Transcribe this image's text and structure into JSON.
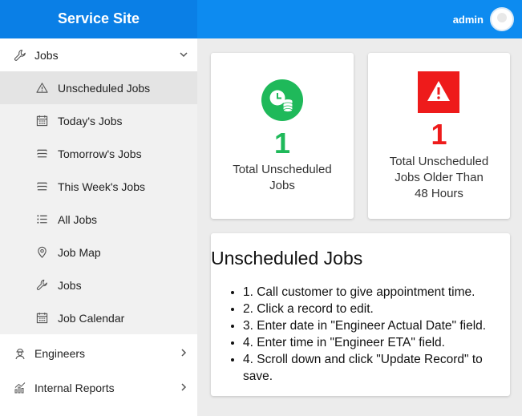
{
  "app": {
    "title": "Service Site",
    "user": "admin"
  },
  "sidebar": {
    "jobs": {
      "label": "Jobs",
      "icon": "wrench-icon"
    },
    "sub_items": [
      {
        "label": "Unscheduled Jobs",
        "icon": "warning-icon",
        "active": true
      },
      {
        "label": "Today's Jobs",
        "icon": "calendar-icon"
      },
      {
        "label": "Tomorrow's Jobs",
        "icon": "stack-icon"
      },
      {
        "label": "This Week's Jobs",
        "icon": "stack-icon"
      },
      {
        "label": "All Jobs",
        "icon": "list-icon"
      },
      {
        "label": "Job Map",
        "icon": "map-pin-icon"
      },
      {
        "label": "Jobs",
        "icon": "wrench-icon"
      },
      {
        "label": "Job Calendar",
        "icon": "calendar-icon"
      }
    ],
    "engineers": {
      "label": "Engineers",
      "icon": "engineer-icon"
    },
    "reports": {
      "label": "Internal Reports",
      "icon": "bar-chart-icon"
    }
  },
  "stats": [
    {
      "value": "1",
      "label_lines": [
        "Total Unscheduled",
        "Jobs"
      ],
      "color": "#1fb95a",
      "icon": "clock-coins-icon"
    },
    {
      "value": "1",
      "label_lines": [
        "Total Unscheduled",
        "Jobs Older Than",
        "48 Hours"
      ],
      "color": "#ee1b1b",
      "icon": "alert-triangle-icon"
    }
  ],
  "info": {
    "title": "Unscheduled Jobs",
    "steps": [
      "1. Call customer to give appointment time.",
      "2. Click a record to edit.",
      "3. Enter date in \"Engineer Actual Date\" field.",
      "4. Enter time in \"Engineer ETA\" field.",
      "4. Scroll down and click \"Update Record\" to save."
    ]
  },
  "colors": {
    "header": "#0d8bf0",
    "brand": "#0a7fe6",
    "green": "#1fb95a",
    "red": "#ee1b1b"
  }
}
